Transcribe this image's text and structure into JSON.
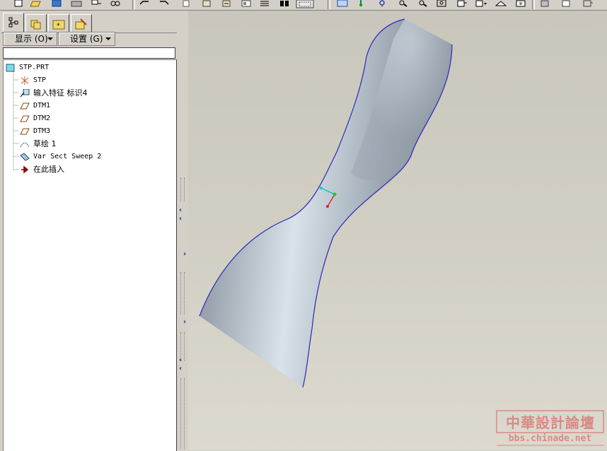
{
  "toolbar": {
    "icons": [
      "new-file-icon",
      "open-folder-icon",
      "save-icon",
      "print-icon",
      "tool-icon",
      "link-icon",
      "undo-icon",
      "redo-icon",
      "copy-icon",
      "paste-icon",
      "paste-special-icon",
      "feature-icon",
      "binoculars-icon",
      "select-box-icon",
      "refit-icon",
      "spin-center-icon",
      "view-icon",
      "zoom-in-icon",
      "zoom-out-icon",
      "zoom-window-icon",
      "orient-icon",
      "saved-views-icon",
      "layers-icon",
      "display-icon",
      "shading-icon",
      "hidden-line-icon",
      "wireframe-icon"
    ]
  },
  "panel": {
    "tabs": [
      "model-tree-tab",
      "layers-tab",
      "folder-tab",
      "favorites-tab"
    ],
    "show_menu": "显示 (O)",
    "settings_menu": "设置 (G)"
  },
  "tree": {
    "root": "STP.PRT",
    "items": [
      {
        "label": "STP",
        "icon": "coordinate-system-icon"
      },
      {
        "label": "输入特征 标识4",
        "icon": "import-feature-icon"
      },
      {
        "label": "DTM1",
        "icon": "datum-plane-icon"
      },
      {
        "label": "DTM2",
        "icon": "datum-plane-icon"
      },
      {
        "label": "DTM3",
        "icon": "datum-plane-icon"
      },
      {
        "label": "草绘 1",
        "icon": "sketch-icon"
      },
      {
        "label": "Var Sect Sweep 2",
        "icon": "sweep-icon"
      },
      {
        "label": "在此插入",
        "icon": "insert-here-arrow-icon"
      }
    ]
  },
  "watermark": {
    "title": "中華設計論壇",
    "url": "bbs.chinade.net"
  },
  "colors": {
    "ui_face": "#d4d0c8",
    "viewport_bg": "#d0cdc2",
    "model_edge": "#2a2ab8",
    "watermark": "#d98a86"
  }
}
